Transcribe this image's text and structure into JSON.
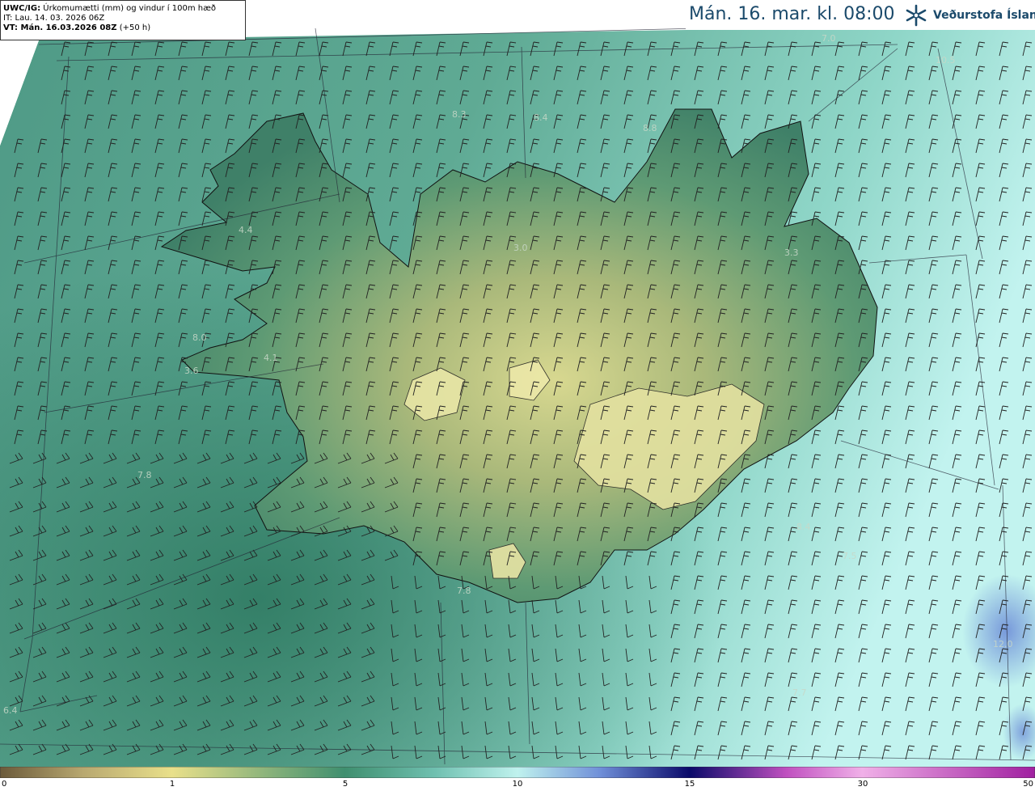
{
  "header": {
    "product_prefix": "UWC/IG:",
    "product_title": "Úrkomumætti (mm) og vindur í 100m hæð",
    "init_time": "IT: Lau. 14. 03. 2026 06Z",
    "valid_prefix": "VT: Mán. 16.03.2026 08Z",
    "valid_offset": "(+50 h)",
    "valid_time_display": "Mán. 16. mar. kl. 08:00",
    "logo_text": "Veðurstofa Íslands",
    "logo_icon": "snowflake-arrows-icon"
  },
  "map_labels": [
    {
      "text": "7.0"
    },
    {
      "text": "10.5"
    },
    {
      "text": "8.3"
    },
    {
      "text": "8.4"
    },
    {
      "text": "8.8"
    },
    {
      "text": "4.4"
    },
    {
      "text": "3.0"
    },
    {
      "text": "3.3"
    },
    {
      "text": "8.0"
    },
    {
      "text": "4.1"
    },
    {
      "text": "3.6"
    },
    {
      "text": "7.8"
    },
    {
      "text": "8.4"
    },
    {
      "text": "7.5"
    },
    {
      "text": "7.8"
    },
    {
      "text": "12.0"
    },
    {
      "text": "7.7"
    },
    {
      "text": "6.4"
    }
  ],
  "colorbar": {
    "unit": "mm",
    "tick_labels": [
      "0",
      "1",
      "5",
      "10",
      "15",
      "30",
      "50"
    ],
    "colors": [
      "#6b5a3a",
      "#c8b870",
      "#e9e08a",
      "#3f8f6f",
      "#6fc0b0",
      "#bff2ee",
      "#6f8fd8",
      "#0a0a6a",
      "#c050c0",
      "#f0b0e8",
      "#a020a0"
    ]
  }
}
